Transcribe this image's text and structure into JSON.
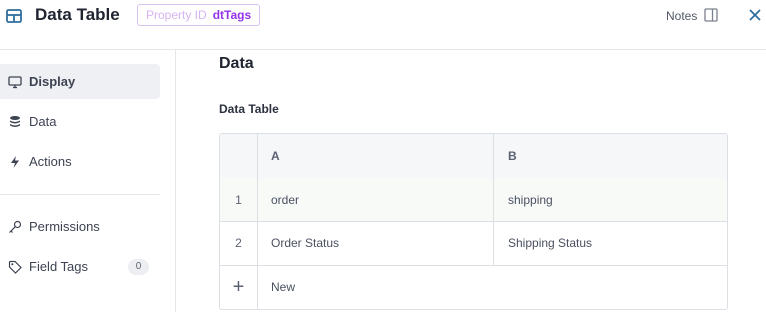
{
  "header": {
    "title": "Data Table",
    "property_label": "Property ID",
    "property_value": "dtTags",
    "notes_label": "Notes"
  },
  "sidebar": {
    "items": [
      {
        "label": "Display",
        "icon": "monitor-icon",
        "active": true
      },
      {
        "label": "Data",
        "icon": "database-icon"
      },
      {
        "label": "Actions",
        "icon": "lightning-icon"
      },
      {
        "label": "Permissions",
        "icon": "key-icon"
      },
      {
        "label": "Field Tags",
        "icon": "tag-icon",
        "count": "0"
      }
    ]
  },
  "main": {
    "section_title": "Data",
    "field_label": "Data Table",
    "table": {
      "headers": [
        "A",
        "B"
      ],
      "rows": [
        {
          "num": "1",
          "cells": [
            "order",
            "shipping"
          ]
        },
        {
          "num": "2",
          "cells": [
            "Order Status",
            "Shipping Status"
          ]
        }
      ],
      "new_label": "New"
    }
  },
  "colors": {
    "accent_purple": "#9333ea",
    "close_blue": "#2f6f9f",
    "active_nav_bg": "#eef0f3"
  }
}
